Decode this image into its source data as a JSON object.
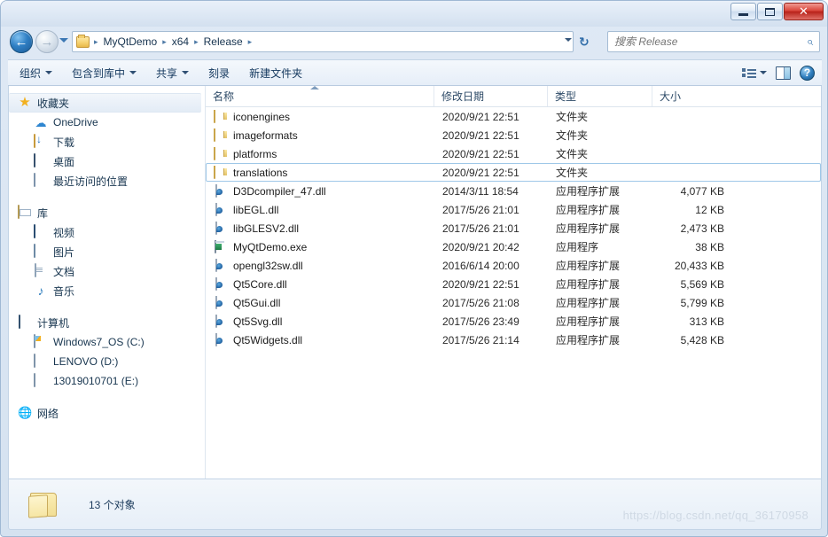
{
  "window": {
    "title": "",
    "buttons": {
      "minimize": "–",
      "maximize": "□",
      "close": "✕"
    }
  },
  "addressbar": {
    "back_icon": "←",
    "forward_icon": "→",
    "history_dropdown_icon": "chevron-down-icon",
    "breadcrumbs": [
      "MyQtDemo",
      "x64",
      "Release"
    ],
    "separator": "▸",
    "dropdown_icon": "▾",
    "refresh_icon": "↻",
    "search_placeholder": "搜索 Release",
    "search_value": "",
    "search_icon": "⌕"
  },
  "toolbar": {
    "items": [
      {
        "label": "组织",
        "has_caret": true
      },
      {
        "label": "包含到库中",
        "has_caret": true
      },
      {
        "label": "共享",
        "has_caret": true
      },
      {
        "label": "刻录",
        "has_caret": false
      },
      {
        "label": "新建文件夹",
        "has_caret": false
      }
    ],
    "view_caret": "▾",
    "help_label": "?"
  },
  "sidebar": {
    "groups": [
      {
        "root": {
          "label": "收藏夹",
          "icon": "star-icon",
          "selected": true
        },
        "items": [
          {
            "label": "OneDrive",
            "icon": "cloud-icon"
          },
          {
            "label": "下载",
            "icon": "downloads-icon"
          },
          {
            "label": "桌面",
            "icon": "desktop-icon"
          },
          {
            "label": "最近访问的位置",
            "icon": "recent-places-icon"
          }
        ]
      },
      {
        "root": {
          "label": "库",
          "icon": "library-icon",
          "selected": false
        },
        "items": [
          {
            "label": "视频",
            "icon": "video-icon"
          },
          {
            "label": "图片",
            "icon": "pictures-icon"
          },
          {
            "label": "文档",
            "icon": "documents-icon"
          },
          {
            "label": "音乐",
            "icon": "music-icon"
          }
        ]
      },
      {
        "root": {
          "label": "计算机",
          "icon": "computer-icon",
          "selected": false
        },
        "items": [
          {
            "label": "Windows7_OS (C:)",
            "icon": "harddrive-windows-icon"
          },
          {
            "label": "LENOVO (D:)",
            "icon": "harddrive-icon"
          },
          {
            "label": "13019010701 (E:)",
            "icon": "harddrive-icon"
          }
        ]
      },
      {
        "root": {
          "label": "网络",
          "icon": "network-icon",
          "selected": false
        },
        "items": []
      }
    ]
  },
  "filelist": {
    "columns": [
      "名称",
      "修改日期",
      "类型",
      "大小"
    ],
    "sort_column": "名称",
    "sort_direction": "ascending",
    "rows": [
      {
        "name": "iconengines",
        "date": "2020/9/21 22:51",
        "type": "文件夹",
        "size": "",
        "icon": "folder-icon",
        "selected": false
      },
      {
        "name": "imageformats",
        "date": "2020/9/21 22:51",
        "type": "文件夹",
        "size": "",
        "icon": "folder-icon",
        "selected": false
      },
      {
        "name": "platforms",
        "date": "2020/9/21 22:51",
        "type": "文件夹",
        "size": "",
        "icon": "folder-icon",
        "selected": false
      },
      {
        "name": "translations",
        "date": "2020/9/21 22:51",
        "type": "文件夹",
        "size": "",
        "icon": "folder-icon",
        "selected": true
      },
      {
        "name": "D3Dcompiler_47.dll",
        "date": "2014/3/11 18:54",
        "type": "应用程序扩展",
        "size": "4,077 KB",
        "icon": "dll-icon",
        "selected": false
      },
      {
        "name": "libEGL.dll",
        "date": "2017/5/26 21:01",
        "type": "应用程序扩展",
        "size": "12 KB",
        "icon": "dll-icon",
        "selected": false
      },
      {
        "name": "libGLESV2.dll",
        "date": "2017/5/26 21:01",
        "type": "应用程序扩展",
        "size": "2,473 KB",
        "icon": "dll-icon",
        "selected": false
      },
      {
        "name": "MyQtDemo.exe",
        "date": "2020/9/21 20:42",
        "type": "应用程序",
        "size": "38 KB",
        "icon": "exe-icon",
        "selected": false
      },
      {
        "name": "opengl32sw.dll",
        "date": "2016/6/14 20:00",
        "type": "应用程序扩展",
        "size": "20,433 KB",
        "icon": "dll-icon",
        "selected": false
      },
      {
        "name": "Qt5Core.dll",
        "date": "2020/9/21 22:51",
        "type": "应用程序扩展",
        "size": "5,569 KB",
        "icon": "dll-icon",
        "selected": false
      },
      {
        "name": "Qt5Gui.dll",
        "date": "2017/5/26 21:08",
        "type": "应用程序扩展",
        "size": "5,799 KB",
        "icon": "dll-icon",
        "selected": false
      },
      {
        "name": "Qt5Svg.dll",
        "date": "2017/5/26 23:49",
        "type": "应用程序扩展",
        "size": "313 KB",
        "icon": "dll-icon",
        "selected": false
      },
      {
        "name": "Qt5Widgets.dll",
        "date": "2017/5/26 21:14",
        "type": "应用程序扩展",
        "size": "5,428 KB",
        "icon": "dll-icon",
        "selected": false
      }
    ]
  },
  "statusbar": {
    "text": "13 个对象",
    "icon": "folder-icon"
  },
  "watermark": "https://blog.csdn.net/qq_36170958",
  "colors": {
    "window_chrome": "#d5e2f0",
    "accent_blue": "#2f7fc4",
    "close_red": "#d9453a",
    "folder_yellow": "#f7dc8c",
    "selection_border": "#9fc8e8"
  }
}
